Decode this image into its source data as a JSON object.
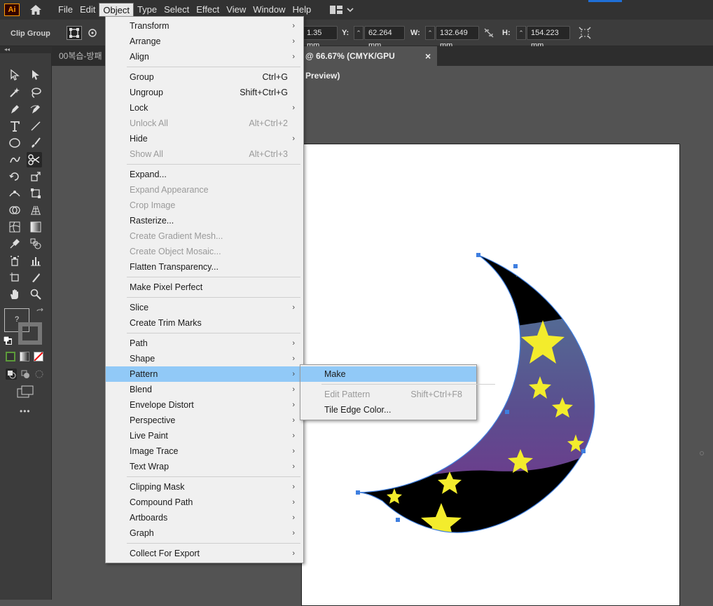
{
  "menubar": {
    "logo": "Ai",
    "items": [
      "File",
      "Edit",
      "Object",
      "Type",
      "Select",
      "Effect",
      "View",
      "Window",
      "Help"
    ],
    "active": "Object"
  },
  "control": {
    "selection_label": "Clip Group",
    "x_value": "1.35 mm",
    "y_label": "Y:",
    "y_value": "62.264 mm",
    "w_label": "W:",
    "w_value": "132.649 mm",
    "h_label": "H:",
    "h_value": "154.223 mm"
  },
  "tabs": [
    {
      "label": "00복습-방패",
      "active": false
    },
    {
      "label": "@ 66.67% (CMYK/GPU Preview)",
      "active": true
    },
    {
      "close": "×"
    }
  ],
  "object_menu": {
    "items": [
      {
        "label": "Transform",
        "submenu": true
      },
      {
        "label": "Arrange",
        "submenu": true
      },
      {
        "label": "Align",
        "submenu": true
      },
      {
        "sep": true
      },
      {
        "label": "Group",
        "shortcut": "Ctrl+G"
      },
      {
        "label": "Ungroup",
        "shortcut": "Shift+Ctrl+G"
      },
      {
        "label": "Lock",
        "submenu": true
      },
      {
        "label": "Unlock All",
        "shortcut": "Alt+Ctrl+2",
        "disabled": true
      },
      {
        "label": "Hide",
        "submenu": true
      },
      {
        "label": "Show All",
        "shortcut": "Alt+Ctrl+3",
        "disabled": true
      },
      {
        "sep": true
      },
      {
        "label": "Expand..."
      },
      {
        "label": "Expand Appearance",
        "disabled": true
      },
      {
        "label": "Crop Image",
        "disabled": true
      },
      {
        "label": "Rasterize..."
      },
      {
        "label": "Create Gradient Mesh...",
        "disabled": true
      },
      {
        "label": "Create Object Mosaic...",
        "disabled": true
      },
      {
        "label": "Flatten Transparency..."
      },
      {
        "sep": true
      },
      {
        "label": "Make Pixel Perfect"
      },
      {
        "sep": true
      },
      {
        "label": "Slice",
        "submenu": true
      },
      {
        "label": "Create Trim Marks"
      },
      {
        "sep": true
      },
      {
        "label": "Path",
        "submenu": true
      },
      {
        "label": "Shape",
        "submenu": true
      },
      {
        "label": "Pattern",
        "submenu": true,
        "highlighted": true
      },
      {
        "label": "Blend",
        "submenu": true
      },
      {
        "label": "Envelope Distort",
        "submenu": true
      },
      {
        "label": "Perspective",
        "submenu": true
      },
      {
        "label": "Live Paint",
        "submenu": true
      },
      {
        "label": "Image Trace",
        "submenu": true
      },
      {
        "label": "Text Wrap",
        "submenu": true
      },
      {
        "sep": true
      },
      {
        "label": "Clipping Mask",
        "submenu": true
      },
      {
        "label": "Compound Path",
        "submenu": true
      },
      {
        "label": "Artboards",
        "submenu": true
      },
      {
        "label": "Graph",
        "submenu": true
      },
      {
        "sep": true
      },
      {
        "label": "Collect For Export",
        "submenu": true
      }
    ]
  },
  "pattern_submenu": {
    "items": [
      {
        "label": "Make",
        "highlighted": true
      },
      {
        "sep": true
      },
      {
        "label": "Edit Pattern",
        "shortcut": "Shift+Ctrl+F8",
        "disabled": true
      },
      {
        "label": "Tile Edge Color..."
      }
    ]
  },
  "colors": {
    "menu_highlight": "#91c9f7",
    "moon_gradient_top": "#4e7f96",
    "moon_gradient_bottom": "#7a2f8a",
    "star": "#f3ec2c",
    "selection": "#3f7fe0"
  },
  "toolbar": {
    "more": "•••"
  }
}
